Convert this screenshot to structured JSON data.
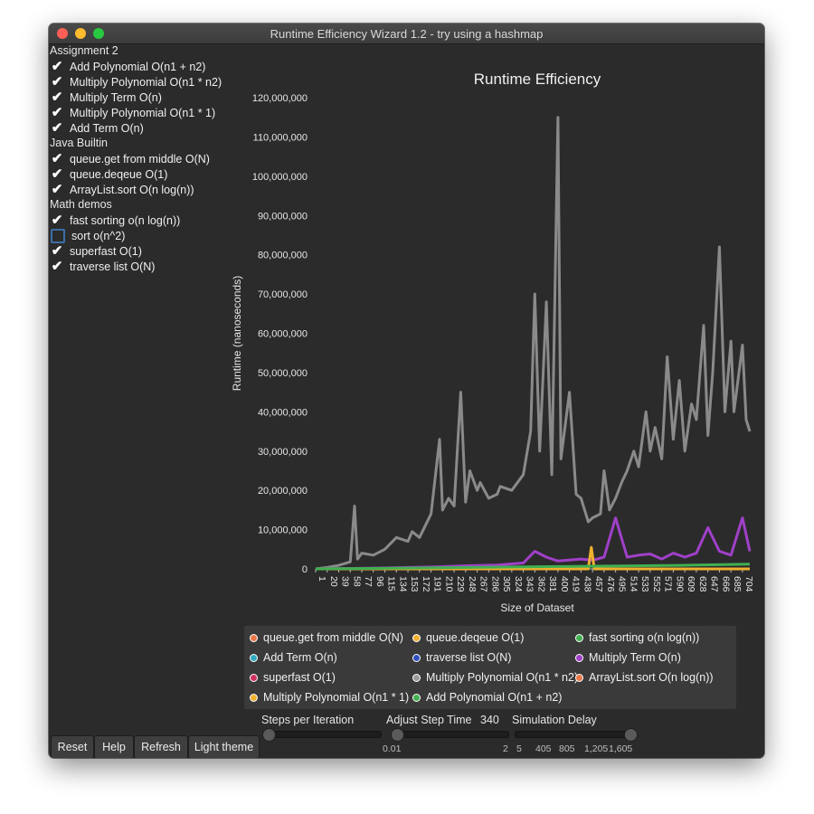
{
  "window": {
    "title": "Runtime Efficiency Wizard 1.2 - try using a hashmap"
  },
  "sidebar": {
    "groups": [
      {
        "title": "Assignment 2",
        "items": [
          {
            "label": "Add Polynomial O(n1 + n2)",
            "checked": true
          },
          {
            "label": "Multiply Polynomial O(n1 * n2)",
            "checked": true
          },
          {
            "label": "Multiply Term O(n)",
            "checked": true
          },
          {
            "label": "Multiply Polynomial O(n1 * 1)",
            "checked": true
          },
          {
            "label": "Add Term O(n)",
            "checked": true
          }
        ]
      },
      {
        "title": "Java Builtin",
        "items": [
          {
            "label": "queue.get from middle O(N)",
            "checked": true
          },
          {
            "label": "queue.deqeue O(1)",
            "checked": true
          },
          {
            "label": "ArrayList.sort O(n log(n))",
            "checked": true
          }
        ]
      },
      {
        "title": "Math demos",
        "items": [
          {
            "label": "fast sorting  o(n log(n))",
            "checked": true
          },
          {
            "label": "sort o(n^2)",
            "checked": false
          },
          {
            "label": "superfast O(1)",
            "checked": true
          },
          {
            "label": "traverse list O(N)",
            "checked": true
          }
        ]
      }
    ]
  },
  "chart_data": {
    "type": "line",
    "title": "Runtime Efficiency",
    "xlabel": "Size of Dataset",
    "ylabel": "Runtime (nanoseconds)",
    "ylim": [
      0,
      120000000
    ],
    "y_ticks": [
      "0",
      "10,000,000",
      "20,000,000",
      "30,000,000",
      "40,000,000",
      "50,000,000",
      "60,000,000",
      "70,000,000",
      "80,000,000",
      "90,000,000",
      "100,000,000",
      "110,000,000",
      "120,000,000"
    ],
    "x_ticks": [
      "1",
      "20",
      "39",
      "58",
      "77",
      "96",
      "115",
      "134",
      "153",
      "172",
      "191",
      "210",
      "229",
      "248",
      "267",
      "286",
      "305",
      "324",
      "343",
      "362",
      "381",
      "400",
      "419",
      "438",
      "457",
      "476",
      "495",
      "514",
      "533",
      "552",
      "571",
      "590",
      "609",
      "628",
      "647",
      "666",
      "685",
      "704"
    ],
    "xlim": [
      1,
      716
    ],
    "series": [
      {
        "name": "Multiply Polynomial O(n1 * n2)",
        "color": "#8a8a8a",
        "x": [
          1,
          20,
          39,
          58,
          65,
          70,
          77,
          96,
          115,
          134,
          153,
          160,
          172,
          191,
          205,
          210,
          220,
          229,
          240,
          248,
          255,
          267,
          272,
          286,
          300,
          305,
          324,
          343,
          355,
          362,
          370,
          381,
          390,
          400,
          405,
          419,
          430,
          438,
          450,
          457,
          470,
          476,
          485,
          495,
          505,
          514,
          525,
          533,
          545,
          552,
          560,
          571,
          580,
          590,
          600,
          609,
          620,
          628,
          640,
          647,
          655,
          666,
          675,
          685,
          690,
          704,
          710,
          716
        ],
        "y": [
          0,
          400000,
          900000,
          1800000,
          16000000,
          2500000,
          4000000,
          3500000,
          5000000,
          8000000,
          7000000,
          9500000,
          8000000,
          14000000,
          33000000,
          15000000,
          18000000,
          16000000,
          45000000,
          17000000,
          25000000,
          20000000,
          22000000,
          18000000,
          19000000,
          21000000,
          20000000,
          24000000,
          35000000,
          70000000,
          30000000,
          68000000,
          24000000,
          115000000,
          28000000,
          45000000,
          19000000,
          18000000,
          12000000,
          13000000,
          14000000,
          25000000,
          15000000,
          18000000,
          22000000,
          25000000,
          30000000,
          26000000,
          40000000,
          30000000,
          36000000,
          28000000,
          54000000,
          33000000,
          48000000,
          30000000,
          42000000,
          38000000,
          62000000,
          34000000,
          50000000,
          82000000,
          40000000,
          58000000,
          40000000,
          57000000,
          38000000,
          35000000
        ]
      },
      {
        "name": "Multiply Term O(n)",
        "color": "#a040c8",
        "x": [
          1,
          100,
          200,
          250,
          300,
          343,
          362,
          381,
          400,
          438,
          457,
          476,
          495,
          514,
          533,
          552,
          571,
          590,
          609,
          628,
          647,
          666,
          685,
          704,
          716
        ],
        "y": [
          0,
          200000,
          500000,
          800000,
          1000000,
          1500000,
          4500000,
          3000000,
          2000000,
          2500000,
          2200000,
          3000000,
          13000000,
          3000000,
          3500000,
          3800000,
          2500000,
          4000000,
          3000000,
          4000000,
          10500000,
          4500000,
          3500000,
          13000000,
          4500000
        ]
      },
      {
        "name": "Multiply Polynomial O(n1 * 1)",
        "color": "#f0b030",
        "x": [
          1,
          440,
          450,
          455,
          460,
          470,
          716
        ],
        "y": [
          0,
          0,
          0,
          5500000,
          0,
          0,
          0
        ]
      },
      {
        "name": "Add Polynomial O(n1 + n2)",
        "color": "#40b050",
        "x": [
          1,
          200,
          400,
          600,
          716
        ],
        "y": [
          0,
          300000,
          600000,
          900000,
          1200000
        ]
      }
    ],
    "legend_position": "bottom",
    "legend": [
      {
        "label": "queue.get from middle O(N)",
        "color": "#e8784a"
      },
      {
        "label": "queue.deqeue O(1)",
        "color": "#f0b030"
      },
      {
        "label": "fast sorting  o(n log(n))",
        "color": "#40b050"
      },
      {
        "label": "Add Term O(n)",
        "color": "#30a8c0"
      },
      {
        "label": "traverse list O(N)",
        "color": "#3050c0"
      },
      {
        "label": "Multiply Term O(n)",
        "color": "#a040c8"
      },
      {
        "label": "superfast O(1)",
        "color": "#d03060"
      },
      {
        "label": "Multiply Polynomial O(n1 * n2)",
        "color": "#9a9a9a"
      },
      {
        "label": "ArrayList.sort O(n log(n))",
        "color": "#e8784a"
      },
      {
        "label": "Multiply Polynomial O(n1 * 1)",
        "color": "#f0b030"
      },
      {
        "label": "Add Polynomial O(n1 + n2)",
        "color": "#40b050"
      }
    ]
  },
  "controls": {
    "steps_label": "Steps per Iteration",
    "step_time_label": "Adjust Step Time",
    "step_time_value": "340",
    "step_time_min": "0.01",
    "step_time_max": "2",
    "delay_label": "Simulation Delay",
    "delay_ticks": [
      "5",
      "405",
      "805",
      "1,205",
      "1,605"
    ]
  },
  "buttons": {
    "reset": "Reset",
    "help": "Help",
    "refresh": "Refresh",
    "light_theme": "Light theme"
  }
}
